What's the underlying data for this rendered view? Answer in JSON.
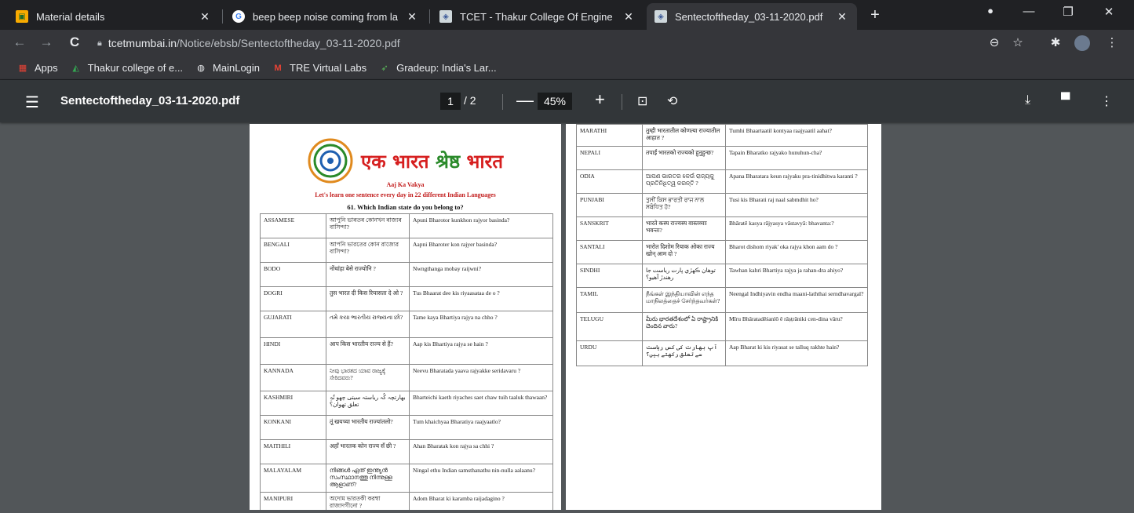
{
  "tabs": [
    {
      "title": "Material details",
      "icon": "classroom-icon"
    },
    {
      "title": "beep beep noise coming from la",
      "icon": "google-icon"
    },
    {
      "title": "TCET - Thakur College Of Engine",
      "icon": "college-icon"
    },
    {
      "title": "Sentectoftheday_03-11-2020.pdf",
      "icon": "college-icon",
      "active": true
    }
  ],
  "address": {
    "host": "tcetmumbai.in",
    "path": "/Notice/ebsb/Sentectoftheday_03-11-2020.pdf"
  },
  "bookmarks": [
    {
      "label": "Apps",
      "icon": "apps-grid-icon"
    },
    {
      "label": "Thakur college of e...",
      "icon": "college-icon"
    },
    {
      "label": "MainLogin",
      "icon": "globe-icon"
    },
    {
      "label": "TRE Virtual Labs",
      "icon": "gmail-icon"
    },
    {
      "label": "Gradeup: India's Lar...",
      "icon": "gradeup-icon"
    }
  ],
  "pdf": {
    "filename": "Sentectoftheday_03-11-2020.pdf",
    "page": "1",
    "total": "/ 2",
    "zoom": "45%"
  },
  "doc": {
    "brand_left": "एक भारत",
    "brand_mid": "श्रेष्ठ",
    "brand_right": "भारत",
    "heading": "Aaj Ka Vakya",
    "subheading": "Let's learn one sentence every day in 22 different Indian Languages",
    "question": "61. Which Indian state do you belong to?",
    "rows_left": [
      [
        "ASSAMESE",
        "আপুনি ভাৰতৰ কোনখন ৰাজ্যৰ বাসিন্দা?",
        "Apuni Bharotor kunkhon rajyor basinda?"
      ],
      [
        "BENGALI",
        "আপনি ভারতের কোন রাজ্যের বাসিন্দা?",
        "Aapni Bharoter kon rajyer basinda?"
      ],
      [
        "BODO",
        "नोंथांंहा बेसे राज्योनि ?",
        "Nwngthanga mobay raijwni?"
      ],
      [
        "DOGRI",
        "तुस भारत दी किस रियासता दे ओ ?",
        "Tus Bhaarat dee kis riyaasataa de o ?"
      ],
      [
        "GUJARATI",
        "તમે કયા ભારતીય રાજ્યના છો?",
        "Tame kaya Bhartiya rajya na chho ?"
      ],
      [
        "HINDI",
        "आप किस भारतीय राज्य से हैं?",
        "Aap kis Bhartiya rajya se hain ?"
      ],
      [
        "KANNADA",
        "ನೀವು ಭಾರತದ ಯಾವ ರಾಜ್ಯಕ್ಕೆ ಸೇರಿದವರು?",
        "Neevu Bharatada yaava rajyakke seridavaru ?"
      ],
      [
        "KASHMIRI",
        "بھارتچہ کُہ ریاستہ سیتی چھو تُہِ تعلق تھوان؟",
        "Bharteichi kaeth riyaches saet chaw tuih taaluk thawaan?"
      ],
      [
        "KONKANI",
        "तूं खयच्या भारतीय राज्यांतलो?",
        "Tum khaichyaa Bharatiya raajyaatlo?"
      ],
      [
        "MAITHILI",
        "अहाँ भारतक कोन राज्य सँ छी ?",
        "Ahan Bharatak kon rajya sa chhi ?"
      ],
      [
        "MALAYALAM",
        "നിങ്ങൾ ഏത് ഇന്ത്യൻ സംസ്ഥാനത്തു നിന്നുള്ള ആളാണ്?",
        "Ningal ethu Indian samsthanathu nin-nulla aalaanu?"
      ],
      [
        "MANIPURI",
        "অদোম ভারতকী করম্বা রাজ্যদগীনো ?",
        "Adom Bharat ki karamba raijadagino ?"
      ]
    ],
    "rows_right": [
      [
        "MARATHI",
        "तुम्ही भारतातील कोणत्या राज्यातील आहात ?",
        "Tumhi Bhaartaatil kontyaa raajyaatil aahat?"
      ],
      [
        "NEPALI",
        "तपाईं भारतको राज्यको हुनुहुन्छ?",
        "Tapain Bharatko rajyako hunuhun-cha?"
      ],
      [
        "ODIA",
        "ଆପଣ ଭାରତର କେଉଁ ରାଜ୍ୟକୁ ପ୍ରତିନିଧିତ୍ୱ କରନ୍ତି ?",
        "Apana Bharatara keun rajyaku pra-tinidhitwa karanti ?"
      ],
      [
        "PUNJABI",
        "ਤੁਸੀਂ ਕਿਸ ਭਾਰਤੀ ਰਾਜ ਨਾਲ ਸਬੰਧਿਤ ਹੋ?",
        "Tusi kis Bharati raj naal sabmdhit ho?"
      ],
      [
        "SANSKRIT",
        "भारते कस्य राज्यस्य वास्तव्याः भवन्तः?",
        "Bhāratē kasya rājyasya vāstavyā: bhavanta:?"
      ],
      [
        "SANTALI",
        "भारोत दिशोम रियाक ओका राज्य खोन् आम दो ?",
        "Bharot dishom riyak' oka rajya khon aam do ?"
      ],
      [
        "SINDHI",
        "توهان ڪهڙي ڀارت رياست جا رهندڙ آهيو؟",
        "Tawhan kahri Bhartiya rajya ja rahan-dra ahiyo?"
      ],
      [
        "TAMIL",
        "நீங்கள் இந்தியாவின் எந்த மாநிலத்தைச் சேர்ந்தவர்கள்?",
        "Neengal Indhiyavin endha maani-laththai serndhavargal?"
      ],
      [
        "TELUGU",
        "మీరు భారతదేశంలో ఏ రాష్ట్రానికి చెందిన వారు?",
        "Mīru Bhāratadēśanlō ē rāṣṭrāniki cen-dina vāru?"
      ],
      [
        "URDU",
        "آپ بھارت کی کس ریاست سے تعلق رکھتے ہیں؟",
        "Aap Bharat ki kis riyasat se talluq rakhte hain?"
      ]
    ]
  }
}
